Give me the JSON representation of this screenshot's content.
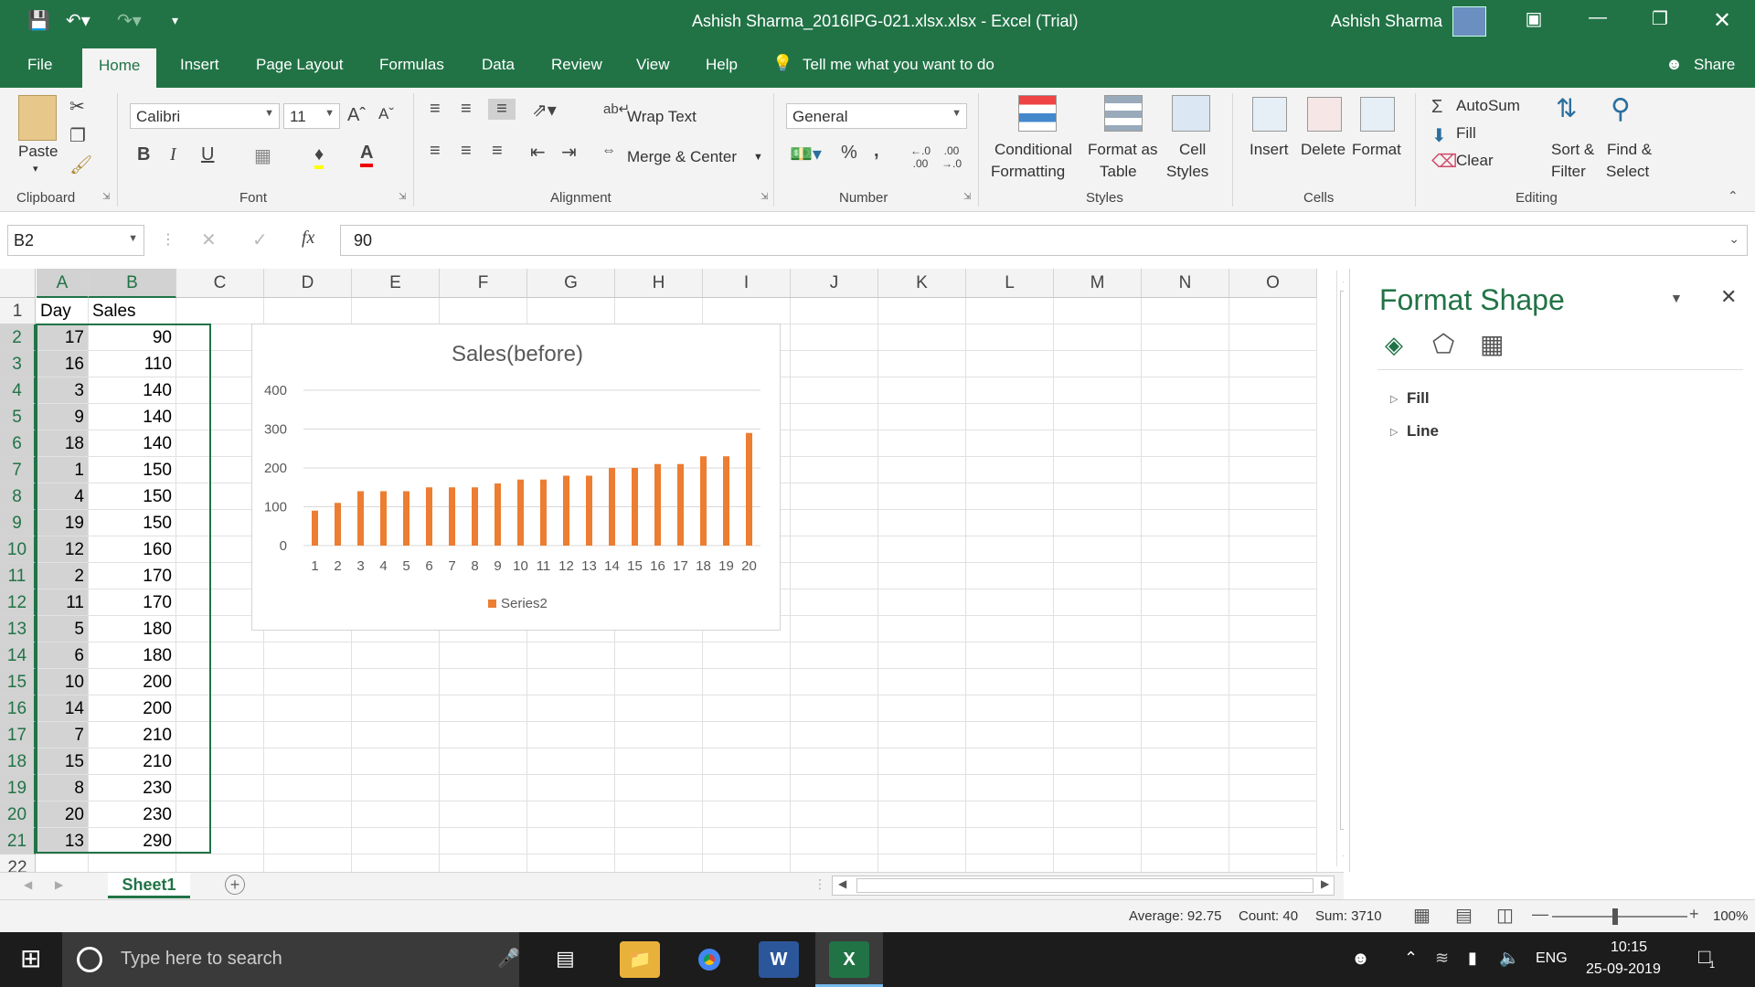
{
  "titlebar": {
    "title": "Ashish Sharma_2016IPG-021.xlsx.xlsx  -  Excel (Trial)",
    "user": "Ashish Sharma"
  },
  "tabs": [
    "File",
    "Home",
    "Insert",
    "Page Layout",
    "Formulas",
    "Data",
    "Review",
    "View",
    "Help"
  ],
  "tell_me": "Tell me what you want to do",
  "share": "Share",
  "ribbon": {
    "clipboard": {
      "paste": "Paste",
      "label": "Clipboard"
    },
    "font": {
      "name": "Calibri",
      "size": "11",
      "bold": "B",
      "italic": "I",
      "underline": "U",
      "label": "Font"
    },
    "alignment": {
      "wrap": "Wrap Text",
      "merge": "Merge & Center",
      "label": "Alignment"
    },
    "number": {
      "format": "General",
      "percent": "%",
      "comma": ",",
      "label": "Number"
    },
    "styles": {
      "conditional": [
        "Conditional",
        "Formatting"
      ],
      "format_table": [
        "Format as",
        "Table"
      ],
      "cell_styles": [
        "Cell",
        "Styles"
      ],
      "label": "Styles"
    },
    "cells": {
      "insert": "Insert",
      "delete": "Delete",
      "format": "Format",
      "label": "Cells"
    },
    "editing": {
      "autosum": "AutoSum",
      "fill": "Fill",
      "clear": "Clear",
      "sort": [
        "Sort &",
        "Filter"
      ],
      "find": [
        "Find &",
        "Select"
      ],
      "label": "Editing"
    }
  },
  "formula_bar": {
    "name_box": "B2",
    "fx": "fx",
    "value": "90"
  },
  "columns": [
    "A",
    "B",
    "C",
    "D",
    "E",
    "F",
    "G",
    "H",
    "I",
    "J",
    "K",
    "L",
    "M",
    "N",
    "O"
  ],
  "header_row": {
    "row": "1",
    "a": "Day",
    "b": "Sales"
  },
  "rows": [
    {
      "row": "2",
      "day": "17",
      "sales": "90"
    },
    {
      "row": "3",
      "day": "16",
      "sales": "110"
    },
    {
      "row": "4",
      "day": "3",
      "sales": "140"
    },
    {
      "row": "5",
      "day": "9",
      "sales": "140"
    },
    {
      "row": "6",
      "day": "18",
      "sales": "140"
    },
    {
      "row": "7",
      "day": "1",
      "sales": "150"
    },
    {
      "row": "8",
      "day": "4",
      "sales": "150"
    },
    {
      "row": "9",
      "day": "19",
      "sales": "150"
    },
    {
      "row": "10",
      "day": "12",
      "sales": "160"
    },
    {
      "row": "11",
      "day": "2",
      "sales": "170"
    },
    {
      "row": "12",
      "day": "11",
      "sales": "170"
    },
    {
      "row": "13",
      "day": "5",
      "sales": "180"
    },
    {
      "row": "14",
      "day": "6",
      "sales": "180"
    },
    {
      "row": "15",
      "day": "10",
      "sales": "200"
    },
    {
      "row": "16",
      "day": "14",
      "sales": "200"
    },
    {
      "row": "17",
      "day": "7",
      "sales": "210"
    },
    {
      "row": "18",
      "day": "15",
      "sales": "210"
    },
    {
      "row": "19",
      "day": "8",
      "sales": "230"
    },
    {
      "row": "20",
      "day": "20",
      "sales": "230"
    },
    {
      "row": "21",
      "day": "13",
      "sales": "290"
    }
  ],
  "row_22": "22",
  "chart_data": {
    "type": "bar",
    "title": "Sales(before)",
    "categories": [
      "1",
      "2",
      "3",
      "4",
      "5",
      "6",
      "7",
      "8",
      "9",
      "10",
      "11",
      "12",
      "13",
      "14",
      "15",
      "16",
      "17",
      "18",
      "19",
      "20"
    ],
    "series": [
      {
        "name": "Series2",
        "values": [
          90,
          110,
          140,
          140,
          140,
          150,
          150,
          150,
          160,
          170,
          170,
          180,
          180,
          200,
          200,
          210,
          210,
          230,
          230,
          290
        ]
      }
    ],
    "yticks": [
      "0",
      "100",
      "200",
      "300",
      "400"
    ],
    "ylim": [
      0,
      400
    ],
    "color": "#ed7d31",
    "legend": "bottom",
    "grid": true
  },
  "format_pane": {
    "title": "Format Shape",
    "sections": [
      "Fill",
      "Line"
    ]
  },
  "sheet_tab": "Sheet1",
  "status": {
    "average": "Average: 92.75",
    "count": "Count: 40",
    "sum": "Sum: 3710",
    "zoom": "100%"
  },
  "taskbar": {
    "search": "Type here to search",
    "lang": "ENG",
    "time": "10:15",
    "date": "25-09-2019",
    "notif": "1"
  }
}
